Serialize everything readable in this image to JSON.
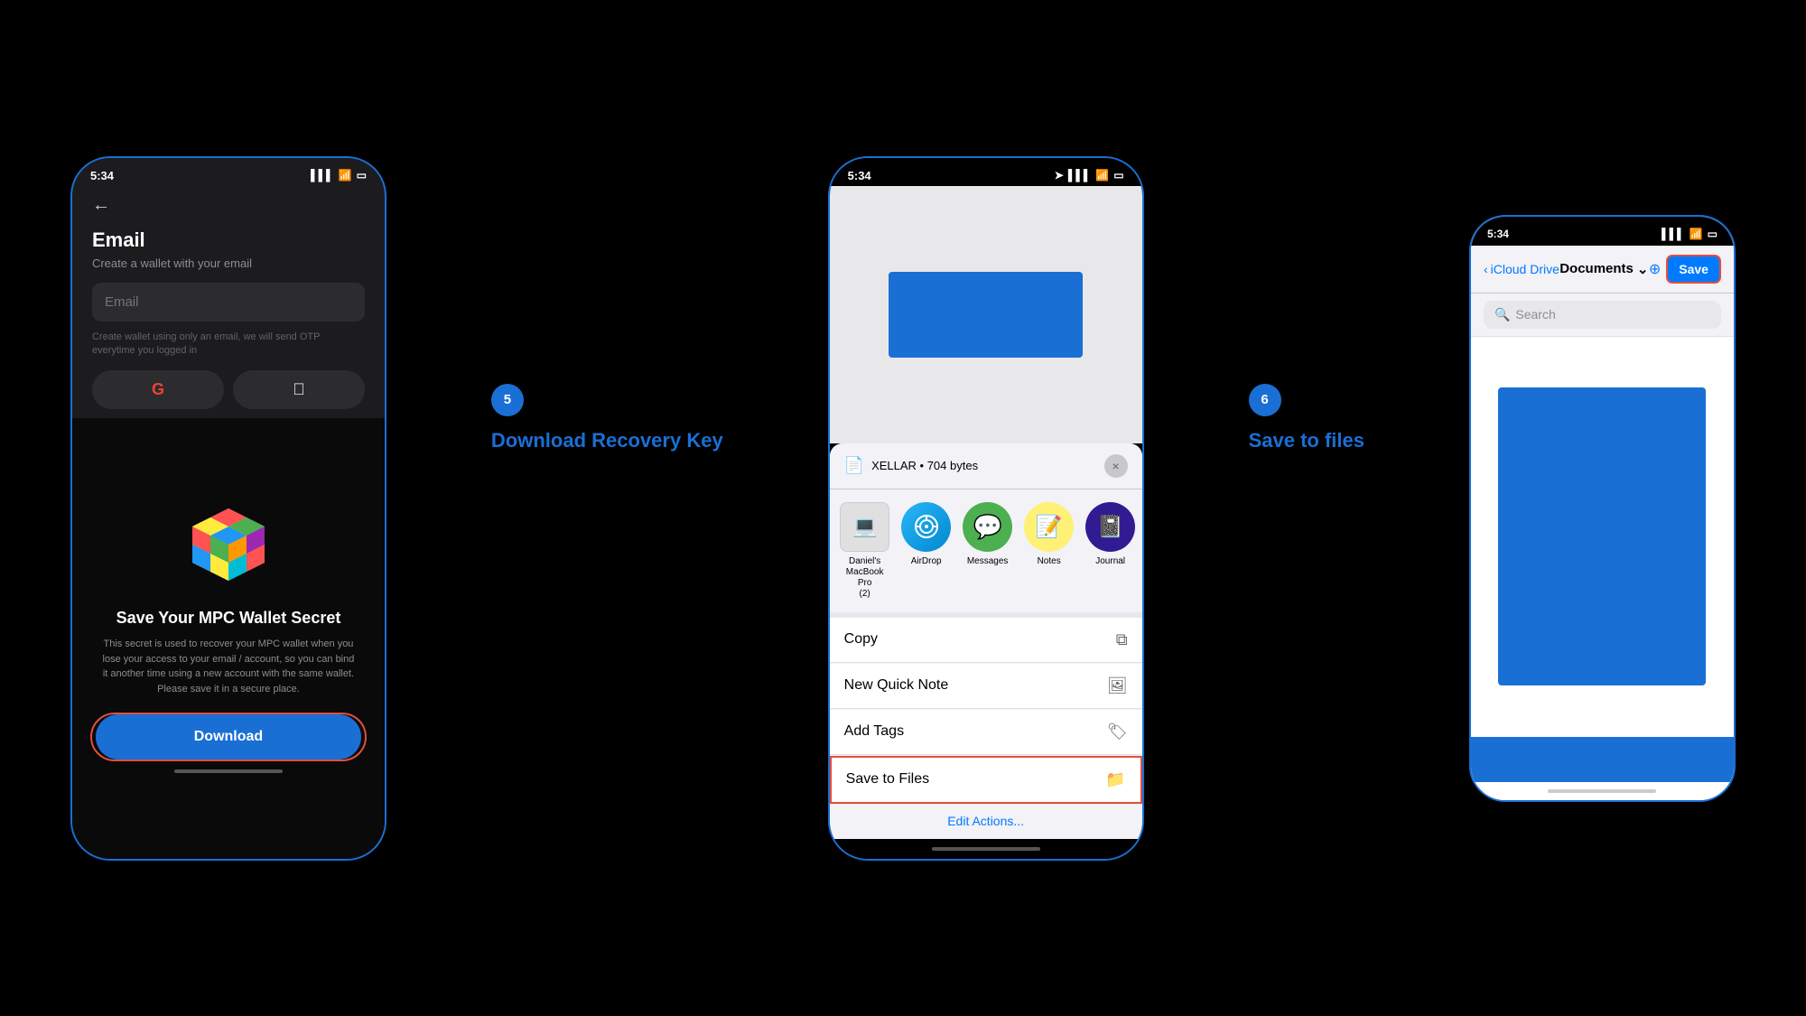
{
  "background": "#000000",
  "step5": {
    "circle": "5",
    "label_plain": "Download ",
    "label_colored": "Recovery Key"
  },
  "step6": {
    "circle": "6",
    "label_plain": "Save ",
    "label_colored": "to files"
  },
  "phone_left": {
    "status_time": "5:34",
    "back_arrow": "←",
    "email_title": "Email",
    "email_subtitle": "Create a wallet with your email",
    "email_placeholder": "Email",
    "email_hint": "Create wallet using only an email, we will send OTP everytime you logged in",
    "google_btn": "G",
    "apple_btn": "",
    "wallet_title": "Save Your MPC Wallet Secret",
    "wallet_desc": "This secret is used to recover your MPC wallet when you lose your access to your email / account, so you can bind it another time using a new account with the same wallet. Please save it in a secure place.",
    "download_btn": "Download"
  },
  "phone_middle": {
    "status_time": "5:34",
    "file_name": "XELLAR • 704 bytes",
    "close_btn": "×",
    "device_label": "Daniel's MacBook Pro (2)",
    "airdrop_label": "AirDrop",
    "messages_label": "Messages",
    "notes_label": "Notes",
    "journal_label": "Journal",
    "copy_label": "Copy",
    "quick_note_label": "New Quick Note",
    "add_tags_label": "Add Tags",
    "save_files_label": "Save to Files",
    "edit_actions_label": "Edit Actions..."
  },
  "phone_right": {
    "status_time": "5:34",
    "back_label": "iCloud Drive",
    "folder_label": "Documents",
    "save_btn": "Save",
    "search_placeholder": "Search"
  },
  "icons": {
    "signal": "▌▌▌",
    "wifi": "WiFi",
    "battery": "🔋",
    "file": "📄",
    "copy": "⧉",
    "note": "📝",
    "tag": "🏷",
    "folder": "📁",
    "search": "🔍",
    "chevron_down": "⌄",
    "chevron_left": "‹",
    "location": "➤"
  }
}
